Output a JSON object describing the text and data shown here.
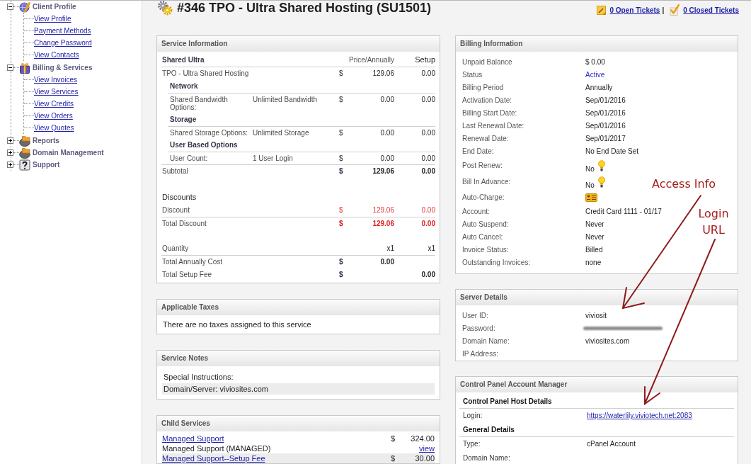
{
  "sidebar": {
    "items": [
      {
        "label": "Client Profile",
        "expanded": true,
        "children": [
          {
            "label": "View Profile"
          },
          {
            "label": "Payment Methods"
          },
          {
            "label": "Change Password"
          },
          {
            "label": "View Contacts"
          }
        ]
      },
      {
        "label": "Billing & Services",
        "expanded": true,
        "children": [
          {
            "label": "View Invoices"
          },
          {
            "label": "View Services"
          },
          {
            "label": "View Credits"
          },
          {
            "label": "View Orders"
          },
          {
            "label": "View Quotes"
          }
        ]
      },
      {
        "label": "Reports",
        "expanded": false
      },
      {
        "label": "Domain Management",
        "expanded": false
      },
      {
        "label": "Support",
        "expanded": false
      }
    ]
  },
  "page_header": {
    "title": "#346 TPO - Ultra Shared Hosting (SU1501)",
    "ticket_links": [
      {
        "label": "0 Open Tickets"
      },
      {
        "label": "0 Closed Tickets"
      }
    ],
    "separator": "|"
  },
  "service_information": {
    "title": "Service Information",
    "rows": [
      {
        "kind": "heading",
        "label": "Shared Ultra",
        "price": "Price/Annually",
        "setup": "Setup"
      },
      {
        "kind": "item",
        "label": "TPO - Ultra Shared Hosting",
        "currency": "$",
        "price": "129.06",
        "setup": "0.00"
      },
      {
        "kind": "section",
        "label": "Network"
      },
      {
        "kind": "option",
        "label": "Shared Bandwidth Options:",
        "value": "Unlimited Bandwidth",
        "currency": "$",
        "price": "0.00",
        "setup": "0.00"
      },
      {
        "kind": "section",
        "label": "Storage"
      },
      {
        "kind": "option",
        "label": "Shared Storage Options:",
        "value": "Unlimited Storage",
        "currency": "$",
        "price": "0.00",
        "setup": "0.00"
      },
      {
        "kind": "section",
        "label": "User Based Options"
      },
      {
        "kind": "option",
        "label": "User Count:",
        "value": "1 User Login",
        "currency": "$",
        "price": "0.00",
        "setup": "0.00"
      },
      {
        "kind": "total",
        "label": "Subtotal",
        "currency": "$",
        "price": "129.06",
        "setup": "0.00"
      },
      {
        "kind": "subheading",
        "label": "Discounts"
      },
      {
        "kind": "discount",
        "label": "Discount",
        "currency": "$",
        "price": "129.06",
        "setup": "0.00"
      },
      {
        "kind": "discount_total",
        "label": "Total Discount",
        "currency": "$",
        "price": "129.06",
        "setup": "0.00"
      },
      {
        "kind": "quantity",
        "label": "Quantity",
        "price": "x1",
        "setup": "x1"
      },
      {
        "kind": "total",
        "label": "Total Annually Cost",
        "currency": "$",
        "price": "0.00"
      },
      {
        "kind": "total",
        "label": "Total Setup Fee",
        "currency": "$",
        "setup": "0.00"
      }
    ]
  },
  "applicable_taxes": {
    "title": "Applicable Taxes",
    "message": "There are no taxes assigned to this service"
  },
  "service_notes": {
    "title": "Service Notes",
    "lines": [
      {
        "text": "Special Instructions:"
      },
      {
        "text": "Domain/Server: viviosites.com"
      }
    ]
  },
  "child_services": {
    "title": "Child Services",
    "items": [
      {
        "name": "Managed Support",
        "currency": "$",
        "amount": "324.00",
        "description": "Managed Support (MANAGED)",
        "action": "view"
      },
      {
        "name": "Managed Support--Setup Fee",
        "currency": "$",
        "amount": "30.00"
      }
    ]
  },
  "billing_information": {
    "title": "Billing Information",
    "rows": [
      {
        "kind": "text",
        "label": "Unpaid Balance",
        "value": "$ 0.00"
      },
      {
        "kind": "status",
        "label": "Status",
        "value": "Active"
      },
      {
        "kind": "text",
        "label": "Billing Period",
        "value": "Annually"
      },
      {
        "kind": "text",
        "label": "Activation Date:",
        "value": "Sep/01/2016"
      },
      {
        "kind": "text",
        "label": "Billing Start Date:",
        "value": "Sep/01/2016"
      },
      {
        "kind": "text",
        "label": "Last Renewal Date:",
        "value": "Sep/01/2016"
      },
      {
        "kind": "text",
        "label": "Renewal Date:",
        "value": "Sep/01/2017"
      },
      {
        "kind": "text",
        "label": "End Date:",
        "value": "No End Date Set"
      },
      {
        "kind": "bulb",
        "label": "Post Renew:",
        "value": "No"
      },
      {
        "kind": "bulb",
        "label": "Bill In Advance:",
        "value": "No"
      },
      {
        "kind": "card",
        "label": "Auto-Charge:"
      },
      {
        "kind": "text",
        "label": "Account:",
        "value": "Credit Card 1111 - 01/17"
      },
      {
        "kind": "text",
        "label": "Auto Suspend:",
        "value": "Never"
      },
      {
        "kind": "text",
        "label": "Auto Cancel:",
        "value": "Never"
      },
      {
        "kind": "text",
        "label": "Invoice Status:",
        "value": "Billed"
      },
      {
        "kind": "text",
        "label": "Outstanding Invoices:",
        "value": "none"
      }
    ]
  },
  "server_details": {
    "title": "Server Details",
    "rows": [
      {
        "kind": "text",
        "label": "User ID:",
        "value": "viviosit"
      },
      {
        "kind": "redacted",
        "label": "Password:"
      },
      {
        "kind": "text",
        "label": "Domain Name:",
        "value": "viviosites.com"
      },
      {
        "kind": "text",
        "label": "IP Address:"
      }
    ]
  },
  "control_panel": {
    "title": "Control Panel Account Manager",
    "sections": [
      {
        "title": "Control Panel Host Details",
        "rows": [
          {
            "kind": "link",
            "label": "Login:",
            "value": "https://waterlily.viviotech.net:2083"
          }
        ]
      },
      {
        "title": "General Details",
        "rows": [
          {
            "kind": "text",
            "label": "Type:",
            "value": "cPanel Account"
          },
          {
            "kind": "text",
            "label": "Domain Name:"
          }
        ]
      }
    ]
  },
  "annotations": [
    {
      "label": "Access Info"
    },
    {
      "label": "Login URL"
    }
  ]
}
